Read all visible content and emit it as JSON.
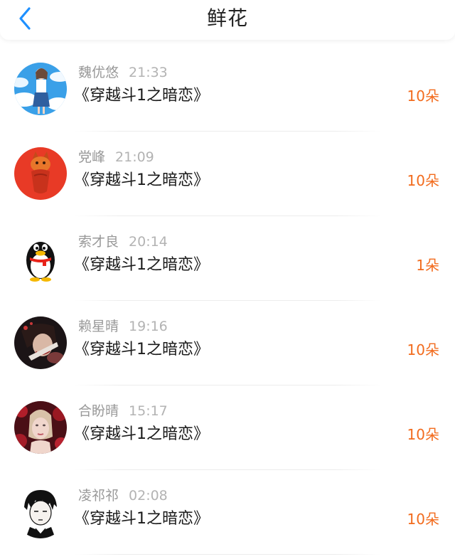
{
  "header": {
    "title": "鲜花",
    "back_icon": "chevron-left-icon",
    "accent_color": "#1e90ff"
  },
  "gifts": [
    {
      "user": "魏优悠",
      "time": "21:33",
      "book": "《穿越斗1之暗恋》",
      "amount": "10朵",
      "avatar": "girl-with-clouds-avatar"
    },
    {
      "user": "党峰",
      "time": "21:09",
      "book": "《穿越斗1之暗恋》",
      "amount": "10朵",
      "avatar": "red-fox-figure-avatar"
    },
    {
      "user": "索才良",
      "time": "20:14",
      "book": "《穿越斗1之暗恋》",
      "amount": "1朵",
      "avatar": "penguin-avatar"
    },
    {
      "user": "赖星晴",
      "time": "19:16",
      "book": "《穿越斗1之暗恋》",
      "amount": "10朵",
      "avatar": "dark-portrait-avatar"
    },
    {
      "user": "合盼晴",
      "time": "15:17",
      "book": "《穿越斗1之暗恋》",
      "amount": "10朵",
      "avatar": "woman-with-roses-avatar"
    },
    {
      "user": "凌祁祁",
      "time": "02:08",
      "book": "《穿越斗1之暗恋》",
      "amount": "10朵",
      "avatar": "anime-boy-avatar"
    }
  ],
  "colors": {
    "amount": "#f26b1d",
    "name": "#999999",
    "book": "#1a1a1a"
  }
}
